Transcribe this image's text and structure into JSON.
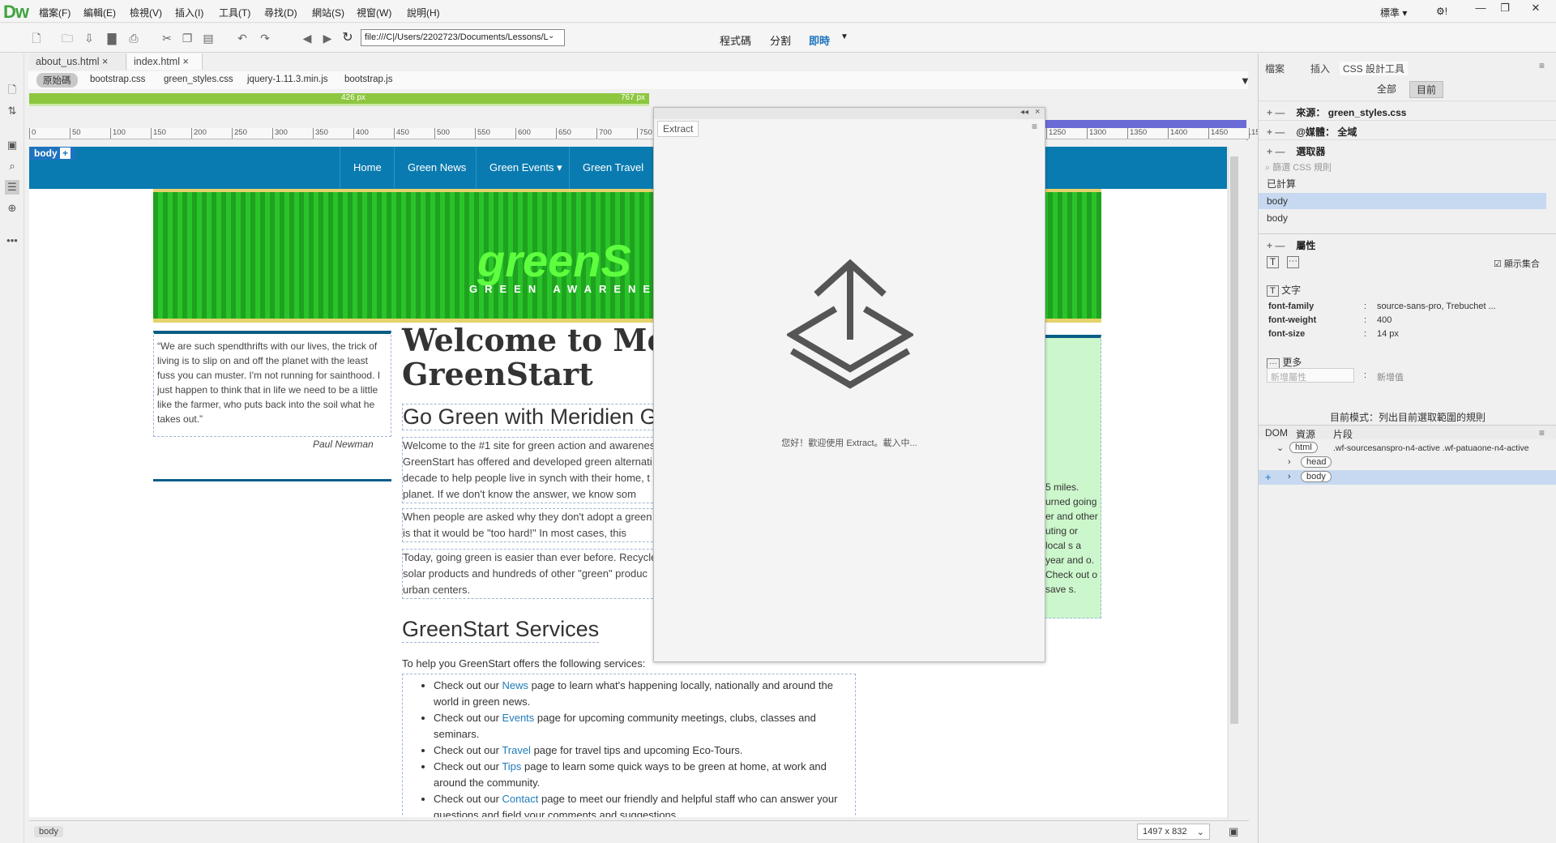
{
  "app": {
    "logo": "Dw",
    "menu": [
      "檔案(F)",
      "編輯(E)",
      "檢視(V)",
      "插入(I)",
      "工具(T)",
      "尋找(D)",
      "網站(S)",
      "視窗(W)",
      "說明(H)"
    ],
    "workspace": "標準",
    "window_controls": [
      "—",
      "❐",
      "✕"
    ]
  },
  "toolbar": {
    "url": "file:///C|/Users/2202723/Documents/Lessons/L",
    "views": [
      "程式碼",
      "分割",
      "即時"
    ],
    "active_view": "即時"
  },
  "doc_tabs": [
    {
      "label": "about_us.html",
      "active": false
    },
    {
      "label": "index.html",
      "active": true
    }
  ],
  "related_files": [
    "原始碼",
    "bootstrap.css",
    "green_styles.css",
    "jquery-1.11.3.min.js",
    "bootstrap.js"
  ],
  "media_queries": {
    "green_bar_1": "426 px",
    "green_bar_2": "767 px"
  },
  "ruler_ticks": [
    "0",
    "50",
    "100",
    "150",
    "200",
    "250",
    "300",
    "350",
    "400",
    "450",
    "500",
    "550",
    "600",
    "650",
    "700",
    "750",
    "1250",
    "1300",
    "1350",
    "1400",
    "1450",
    "15"
  ],
  "page": {
    "body_tag": "body",
    "nav": [
      "Home",
      "Green News",
      "Green Events ▾",
      "Green Travel"
    ],
    "banner_text": "greenS",
    "banner_subtext": "GREEN AWARENES",
    "quote": "“We are such spendthrifts with our lives, the trick of living is to slip on and off the planet with the least fuss you can muster. I'm not running for sainthood. I just happen to think that in life we need to be a little like the farmer, who puts back into the soil what he takes out.”",
    "quote_author": "Paul Newman",
    "welcome_line1": "Welcome to Meri",
    "welcome_line2": "GreenStart",
    "go_green": "Go Green with Meridien G",
    "para1": "Welcome to the #1 site for green action and awarenes GreenStart has offered and developed green alternati decade to help people live in synch with their home, t the planet. If we don't know the answer, we know som",
    "para2": "When people are asked why they don't adopt a green give is that it would be \"too hard!\" In most cases, this",
    "para3": "Today, going green is easier than ever before. Recycle solar products and hundreds of other \"green\" produc urban centers.",
    "services_heading": "GreenStart Services",
    "services_intro": "To help you GreenStart offers the following services:",
    "services": [
      {
        "pre": "Check out our ",
        "link": "News",
        "post": " page to learn what's happening locally, nationally and around the world in green news."
      },
      {
        "pre": "Check out our ",
        "link": "Events",
        "post": " page for upcoming community meetings, clubs, classes and seminars."
      },
      {
        "pre": "Check out our ",
        "link": "Travel",
        "post": " page for travel tips and upcoming Eco-Tours."
      },
      {
        "pre": "Check out our ",
        "link": "Tips",
        "post": " page to learn some quick ways to be green at home, at work and around the community."
      },
      {
        "pre": "Check out our ",
        "link": "Contact",
        "post": " page to meet our friendly and helpful staff who can answer your questions and field your comments and suggestions."
      }
    ],
    "sidebar_fragment": "5 miles. urned going er and other uting or local s a year and o. Check out o save s."
  },
  "extract": {
    "tab": "Extract",
    "message": "您好！歡迎使用 Extract。載入中..."
  },
  "status": {
    "tag": "body",
    "size": "1497 x 832"
  },
  "right_panel": {
    "tabs": [
      "檔案",
      "插入",
      "CSS 設計工具"
    ],
    "mode_buttons": [
      "全部",
      "目前"
    ],
    "source_label": "來源：",
    "source_value": "green_styles.css",
    "media_label": "@媒體：",
    "media_value": "全域",
    "selectors_label": "選取器",
    "filter_placeholder": "篩選 CSS 規則",
    "computed": "已計算",
    "selectors": [
      "body",
      "body"
    ],
    "properties_label": "屬性",
    "show_set": "顯示集合",
    "text_label": "文字",
    "props": [
      {
        "name": "font-family",
        "value": "source-sans-pro, Trebuchet ..."
      },
      {
        "name": "font-weight",
        "value": "400"
      },
      {
        "name": "font-size",
        "value": "14 px"
      }
    ],
    "more_label": "更多",
    "add_prop_placeholder": "新增屬性",
    "add_value": "新增值",
    "mode_text": "目前模式：列出目前選取範圍的規則",
    "dom_tabs": [
      "DOM",
      "資源",
      "片段"
    ],
    "dom_html": "html",
    "dom_html_class": ".wf-sourcesanspro-n4-active .wf-patuaone-n4-active",
    "dom_head": "head",
    "dom_body": "body"
  }
}
